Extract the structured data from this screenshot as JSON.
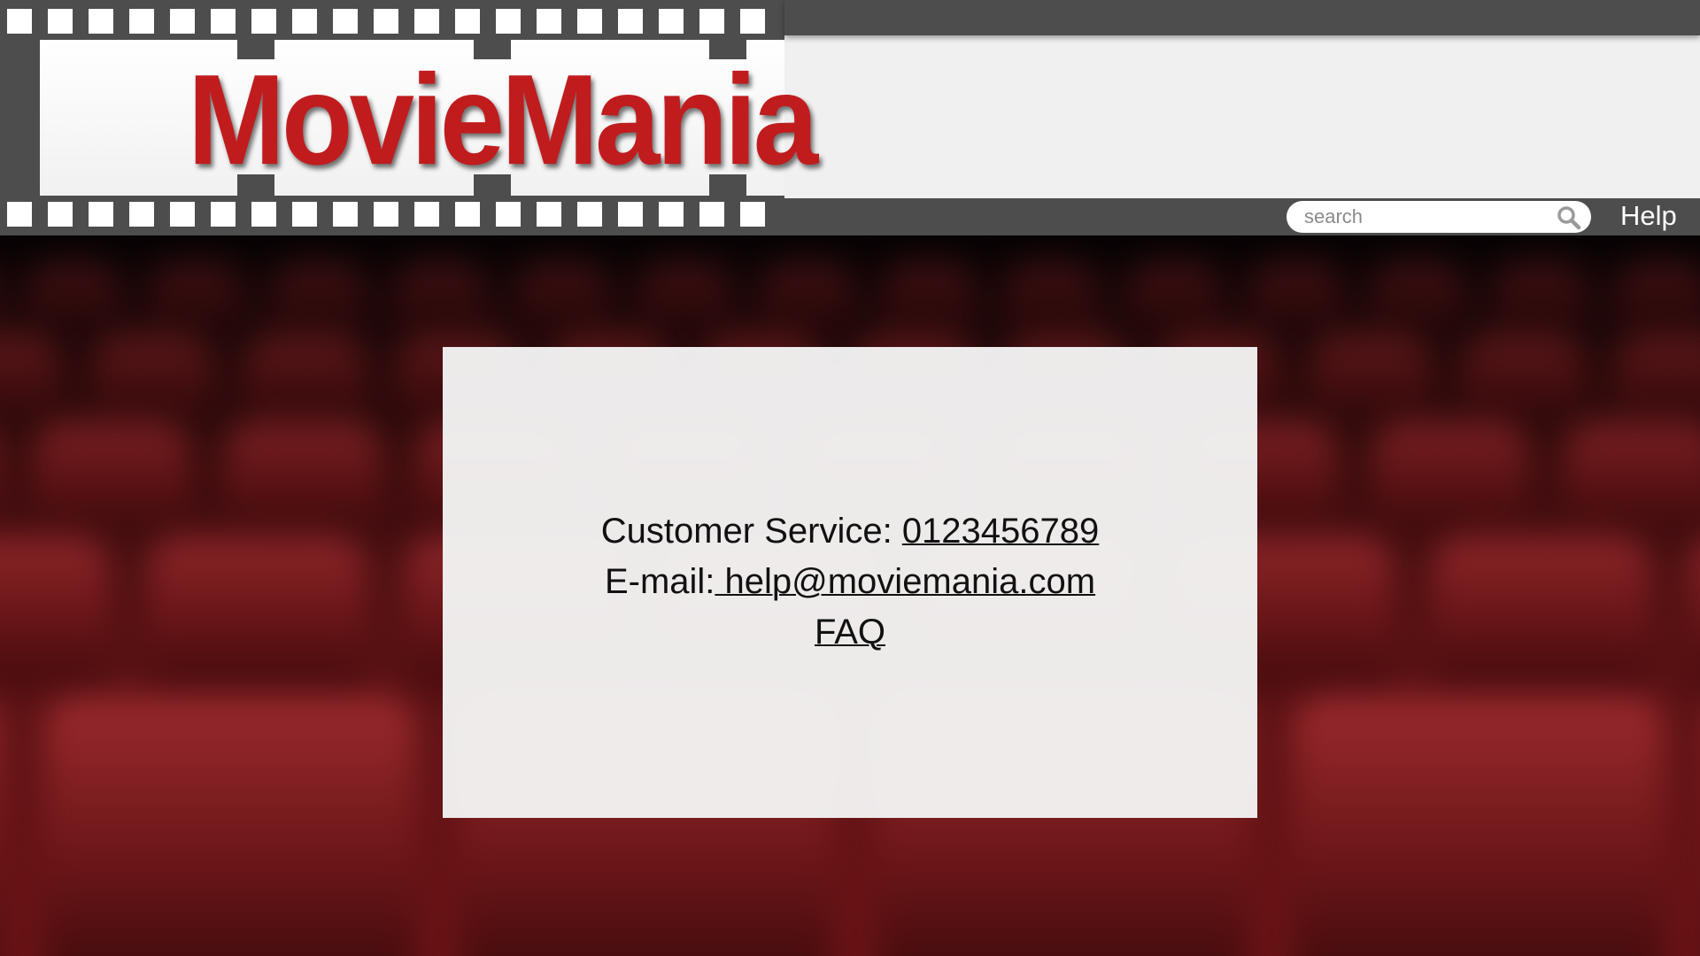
{
  "brand": {
    "logo_text": "MovieMania",
    "logo_color": "#c01c1e"
  },
  "header": {
    "bar_color": "#4d4d4d",
    "search": {
      "placeholder": "search",
      "value": "",
      "icon": "search-icon"
    },
    "help_label": "Help"
  },
  "contact": {
    "phone_label": "Customer Service: ",
    "phone_value": "0123456789",
    "email_label": "E-mail:",
    "email_value": " help@moviemania.com",
    "faq_label": "FAQ"
  },
  "background": {
    "theme": "cinema-seats",
    "seat_color": "#8a1c20"
  }
}
